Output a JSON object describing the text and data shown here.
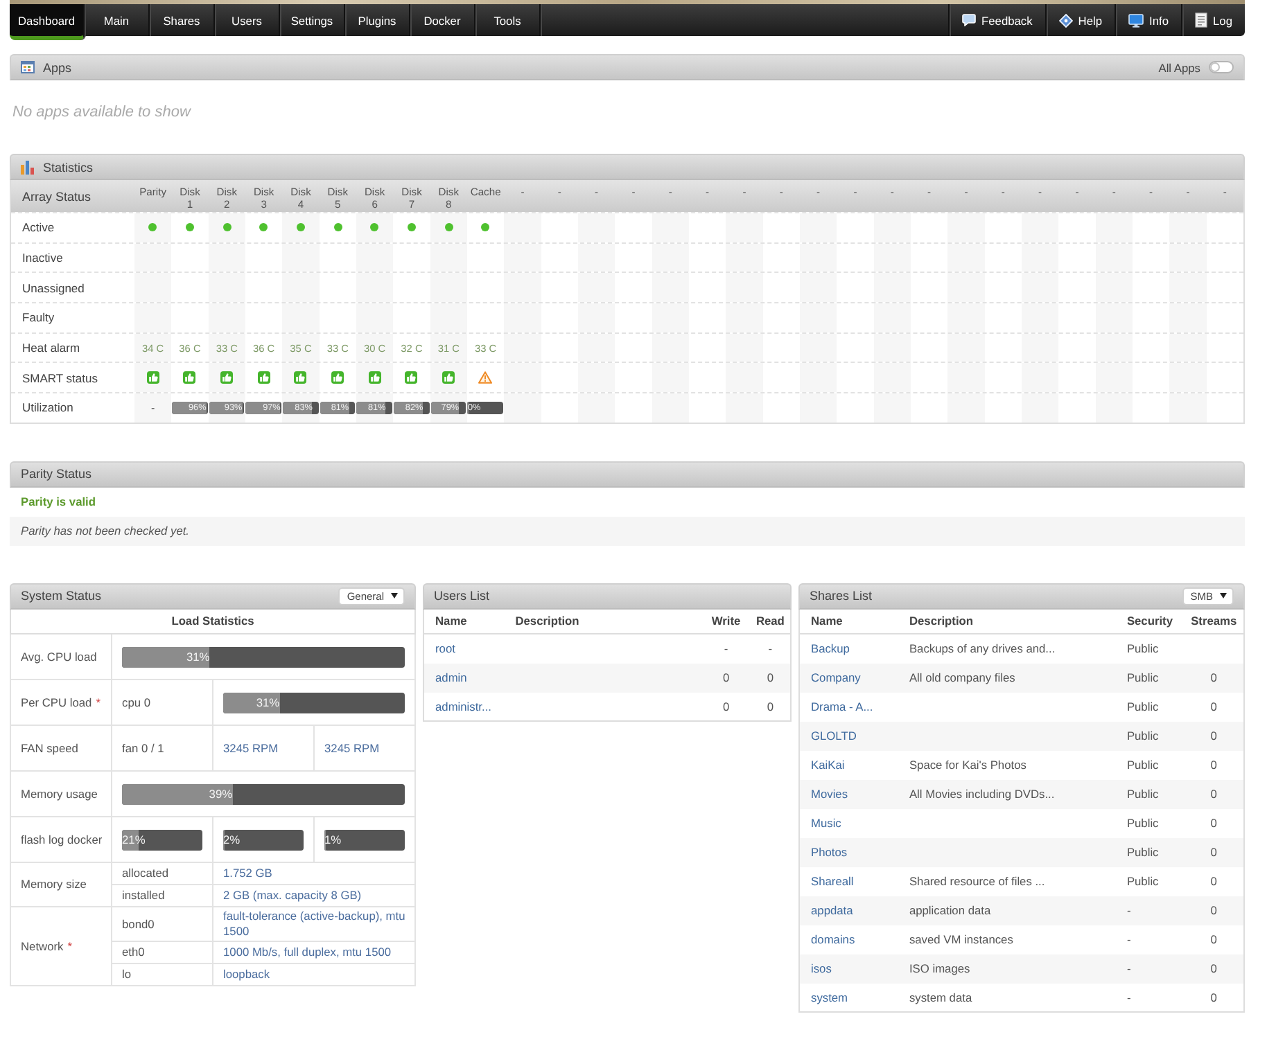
{
  "nav": {
    "tabs": [
      {
        "label": "Dashboard",
        "selected": true
      },
      {
        "label": "Main",
        "selected": false
      },
      {
        "label": "Shares",
        "selected": false
      },
      {
        "label": "Users",
        "selected": false
      },
      {
        "label": "Settings",
        "selected": false
      },
      {
        "label": "Plugins",
        "selected": false
      },
      {
        "label": "Docker",
        "selected": false
      },
      {
        "label": "Tools",
        "selected": false
      }
    ],
    "links": [
      {
        "label": "Feedback",
        "kind": "feedback"
      },
      {
        "label": "Help",
        "kind": "help"
      },
      {
        "label": "Info",
        "kind": "info"
      },
      {
        "label": "Log",
        "kind": "log"
      }
    ]
  },
  "apps": {
    "title": "Apps",
    "toggle": {
      "label": "All Apps",
      "on": false
    },
    "empty_message": "No apps available to show"
  },
  "statistics": {
    "title": "Statistics",
    "array_status": {
      "title": "Array Status",
      "rows": [
        {
          "label": "Active",
          "kind": "active"
        },
        {
          "label": "Inactive",
          "kind": "inactive"
        },
        {
          "label": "Unassigned",
          "kind": "unassigned"
        },
        {
          "label": "Faulty",
          "kind": "faulty"
        },
        {
          "label": "Heat alarm",
          "kind": "temperature"
        },
        {
          "label": "SMART status",
          "kind": "smart"
        },
        {
          "label": "Utilization",
          "kind": "utilization"
        }
      ],
      "devices": [
        {
          "label": "Parity",
          "active": true,
          "temperature": "34 C",
          "smart_ok": true,
          "utilization": "-"
        },
        {
          "label": "Disk 1",
          "active": true,
          "temperature": "36 C",
          "smart_ok": true,
          "utilization": "96%",
          "level": 0.96
        },
        {
          "label": "Disk 2",
          "active": true,
          "temperature": "33 C",
          "smart_ok": true,
          "utilization": "93%",
          "level": 0.93
        },
        {
          "label": "Disk 3",
          "active": true,
          "temperature": "36 C",
          "smart_ok": true,
          "utilization": "97%",
          "level": 0.97
        },
        {
          "label": "Disk 4",
          "active": true,
          "temperature": "35 C",
          "smart_ok": true,
          "utilization": "83%",
          "level": 0.83
        },
        {
          "label": "Disk 5",
          "active": true,
          "temperature": "33 C",
          "smart_ok": true,
          "utilization": "81%",
          "level": 0.81
        },
        {
          "label": "Disk 6",
          "active": true,
          "temperature": "30 C",
          "smart_ok": true,
          "utilization": "81%",
          "level": 0.81
        },
        {
          "label": "Disk 7",
          "active": true,
          "temperature": "32 C",
          "smart_ok": true,
          "utilization": "82%",
          "level": 0.82
        },
        {
          "label": "Disk 8",
          "active": true,
          "temperature": "31 C",
          "smart_ok": true,
          "utilization": "79%",
          "level": 0.79
        },
        {
          "label": "Cache",
          "active": true,
          "temperature": "33 C",
          "smart_ok": false,
          "utilization": "0%",
          "level": 0
        },
        {
          "label": "-"
        },
        {
          "label": "-"
        },
        {
          "label": "-"
        },
        {
          "label": "-"
        },
        {
          "label": "-"
        },
        {
          "label": "-"
        },
        {
          "label": "-"
        },
        {
          "label": "-"
        },
        {
          "label": "-"
        },
        {
          "label": "-"
        },
        {
          "label": "-"
        },
        {
          "label": "-"
        },
        {
          "label": "-"
        },
        {
          "label": "-"
        },
        {
          "label": "-"
        },
        {
          "label": "-"
        },
        {
          "label": "-"
        },
        {
          "label": "-"
        },
        {
          "label": "-"
        },
        {
          "label": "-"
        }
      ]
    }
  },
  "parity": {
    "title": "Parity Status",
    "status": "Parity is valid",
    "note": "Parity has not been checked yet."
  },
  "system_status": {
    "title": "System Status",
    "view": "General",
    "heading": "Load Statistics",
    "rows": [
      {
        "kind": "bar",
        "label": "Avg. CPU load",
        "bars": [
          {
            "level": 0.31,
            "text": "31%"
          }
        ]
      },
      {
        "kind": "named_bar",
        "label": "Per CPU load",
        "mark": "*",
        "name": "cpu 0",
        "bars": [
          {
            "level": 0.31,
            "text": "31%"
          }
        ]
      },
      {
        "kind": "values",
        "label": "FAN speed",
        "name": "fan 0 / 1",
        "values": [
          "3245 RPM",
          "3245 RPM"
        ]
      },
      {
        "kind": "bar",
        "label": "Memory usage",
        "bars": [
          {
            "level": 0.39,
            "text": "39%"
          }
        ]
      },
      {
        "kind": "bars",
        "label": "flash log docker",
        "bars": [
          {
            "level": 0.21,
            "text": "21%"
          },
          {
            "level": 0.02,
            "text": "2%"
          },
          {
            "level": 0.01,
            "text": "1%"
          }
        ]
      },
      {
        "kind": "pairs",
        "label": "Memory size",
        "pairs": [
          {
            "name": "allocated",
            "value": "1.752 GB"
          },
          {
            "name": "installed",
            "value": "2 GB (max. capacity 8 GB)"
          }
        ]
      },
      {
        "kind": "pairs",
        "label": "Network",
        "mark": "*",
        "pairs": [
          {
            "name": "bond0",
            "value": "fault-tolerance (active-backup), mtu 1500"
          },
          {
            "name": "eth0",
            "value": "1000 Mb/s, full duplex, mtu 1500"
          },
          {
            "name": "lo",
            "value": "loopback"
          }
        ]
      }
    ]
  },
  "users": {
    "title": "Users List",
    "columns": [
      "Name",
      "Description",
      "Write",
      "Read"
    ],
    "rows": [
      {
        "name": "root",
        "write": "-",
        "read": "-"
      },
      {
        "name": "admin",
        "write": "0",
        "read": "0"
      },
      {
        "name": "administr...",
        "write": "0",
        "read": "0"
      }
    ]
  },
  "shares": {
    "title": "Shares List",
    "protocol": "SMB",
    "columns": [
      "Name",
      "Description",
      "Security",
      "Streams"
    ],
    "rows": [
      {
        "name": "Backup",
        "description": "Backups of any drives and...",
        "security": "Public"
      },
      {
        "name": "Company",
        "description": "All old company files",
        "security": "Public",
        "streams": "0"
      },
      {
        "name": "Drama - A...",
        "security": "Public",
        "streams": "0"
      },
      {
        "name": "GLOLTD",
        "security": "Public",
        "streams": "0"
      },
      {
        "name": "KaiKai",
        "description": "Space for Kai's Photos",
        "security": "Public",
        "streams": "0"
      },
      {
        "name": "Movies",
        "description": "All Movies including DVDs...",
        "security": "Public",
        "streams": "0"
      },
      {
        "name": "Music",
        "security": "Public",
        "streams": "0"
      },
      {
        "name": "Photos",
        "security": "Public",
        "streams": "0"
      },
      {
        "name": "Shareall",
        "description": "Shared resource of files ...",
        "security": "Public",
        "streams": "0"
      },
      {
        "name": "appdata",
        "description": "application data",
        "security": "-",
        "streams": "0"
      },
      {
        "name": "domains",
        "description": "saved VM instances",
        "security": "-",
        "streams": "0"
      },
      {
        "name": "isos",
        "description": "ISO images",
        "security": "-",
        "streams": "0"
      },
      {
        "name": "system",
        "description": "system data",
        "security": "-",
        "streams": "0"
      }
    ]
  }
}
